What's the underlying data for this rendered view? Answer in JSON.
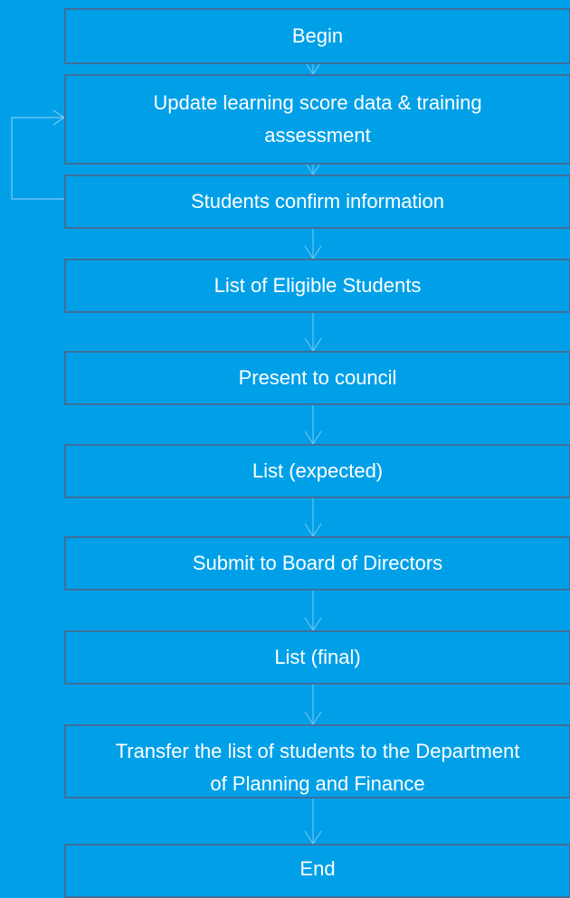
{
  "diagram": {
    "steps": [
      {
        "label": "Begin"
      },
      {
        "label": "Update learning score data &  training assessment"
      },
      {
        "label": "Students confirm information"
      },
      {
        "label": "List of Eligible Students"
      },
      {
        "label": "Present to council"
      },
      {
        "label": "List (expected)"
      },
      {
        "label": "Submit to Board of Directors"
      },
      {
        "label": "List (final)"
      },
      {
        "label": "Transfer the list of students to the Department of Planning and Finance"
      },
      {
        "label": "End"
      }
    ],
    "colors": {
      "background": "#00a0e8",
      "box_border": "#3f6f9a",
      "text": "#ffffff",
      "connector": "#7ec7f2"
    }
  }
}
